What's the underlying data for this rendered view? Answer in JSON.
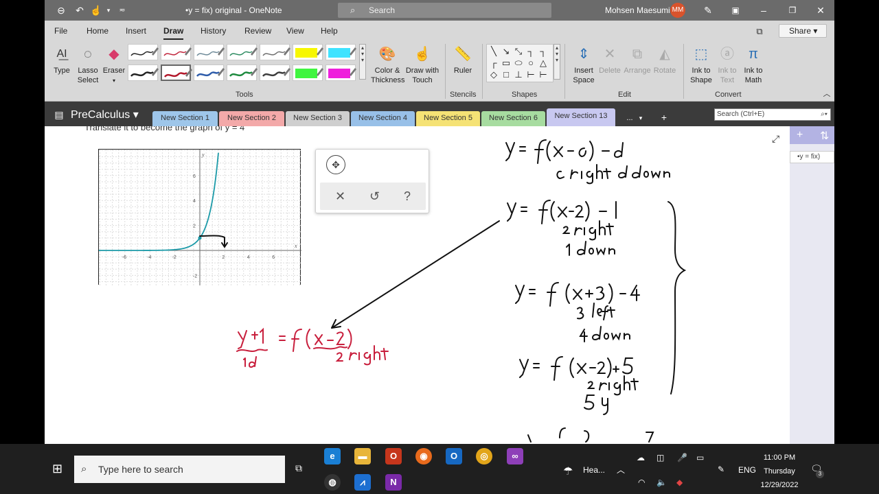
{
  "window": {
    "doc_title": "•y = fix) original  -  OneNote",
    "search_placeholder": "Search",
    "user_name": "Mohsen Maesumi",
    "user_initials": "MM"
  },
  "menu": {
    "items": [
      "File",
      "Home",
      "Insert",
      "Draw",
      "History",
      "Review",
      "View",
      "Help"
    ],
    "active": "Draw",
    "share": "Share"
  },
  "ribbon": {
    "type": "Type",
    "lasso": "Lasso Select",
    "eraser": "Eraser",
    "color_thickness": "Color & Thickness",
    "draw_touch": "Draw with Touch",
    "ruler": "Ruler",
    "insert_space": "Insert Space",
    "delete": "Delete",
    "arrange": "Arrange",
    "rotate": "Rotate",
    "ink_shape": "Ink to Shape",
    "ink_text": "Ink to Text",
    "ink_math": "Ink to Math",
    "groups": {
      "tools": "Tools",
      "stencils": "Stencils",
      "shapes": "Shapes",
      "edit": "Edit",
      "convert": "Convert"
    },
    "pen_colors": [
      "#222222",
      "#c0243b",
      "#6e8a98",
      "#2c8a60",
      "#6e6e6e",
      "#f7f700",
      "#3fe3ff",
      "#222222",
      "#b2182b",
      "#2e5caa",
      "#1e8a3e",
      "#3d3d3d",
      "#3ff53f",
      "#ef1fdc"
    ]
  },
  "sections": {
    "notebook": "PreCalculus",
    "tabs": [
      {
        "label": "New Section 1",
        "color": "#9ec6ea"
      },
      {
        "label": "New Section 2",
        "color": "#f3a9a9"
      },
      {
        "label": "New Section 3",
        "color": "#cfcfcf"
      },
      {
        "label": "New Section 4",
        "color": "#98c0e8"
      },
      {
        "label": "New Section 5",
        "color": "#f5e275"
      },
      {
        "label": "New Section 6",
        "color": "#a7dca0"
      },
      {
        "label": "New Section 13",
        "color": "#c8c8f0"
      }
    ],
    "more": "...",
    "add": "+",
    "search_placeholder": "Search (Ctrl+E)"
  },
  "page_list": {
    "pages": [
      "•y = fix)"
    ]
  },
  "page": {
    "graph": {
      "x_ticks": [
        "-6",
        "-4",
        "-2",
        "2",
        "4",
        "6"
      ],
      "y_ticks": [
        "6",
        "4",
        "2",
        "-2"
      ],
      "x_label": "x",
      "y_label": "y"
    },
    "partial_text": "Translate it to become the graph of y = 4"
  },
  "taskbar": {
    "search_placeholder": "Type here to search",
    "weather": "Hea...",
    "lang": "ENG",
    "time": "11:00 PM",
    "day": "Thursday",
    "date": "12/29/2022",
    "notif_count": "3"
  }
}
